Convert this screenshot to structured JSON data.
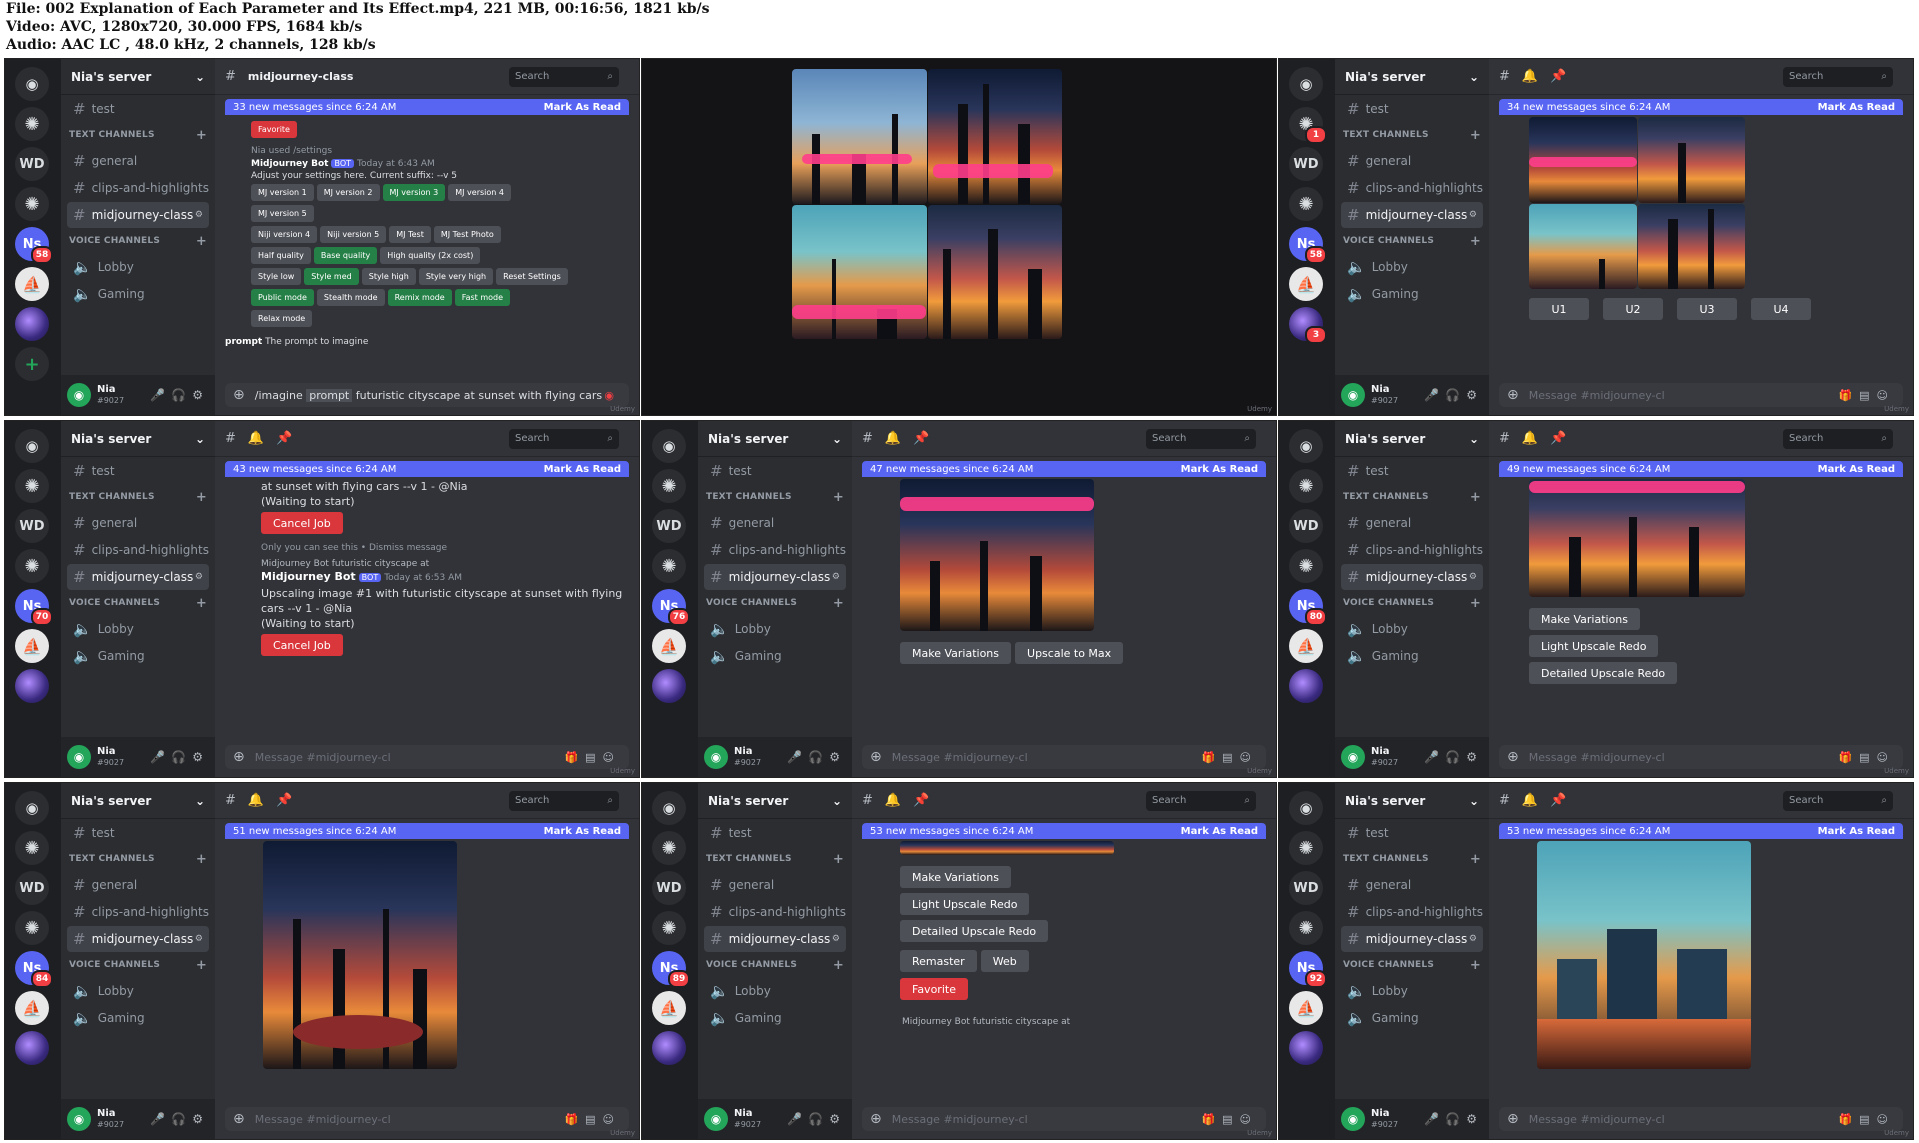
{
  "file_info": {
    "file": "File: 002 Explanation of Each Parameter and Its Effect.mp4, 221 MB, 00:16:56, 1821 kb/s",
    "video": "Video: AVC, 1280x720, 30.000 FPS, 1684 kb/s",
    "audio": "Audio: AAC LC , 48.0 kHz, 2 channels, 128 kb/s"
  },
  "discord": {
    "server_name": "Nia's server",
    "channels": {
      "test": "test",
      "text_category": "TEXT CHANNELS",
      "general": "general",
      "clips": "clips-and-highlights",
      "midjourney": "midjourney-class",
      "voice_category": "VOICE CHANNELS",
      "lobby": "Lobby",
      "gaming": "Gaming"
    },
    "rail": {
      "wd": "WD",
      "ns": "Ns"
    },
    "user": {
      "name": "Nia",
      "tag": "#9027"
    },
    "search_placeholder": "Search",
    "mark_as_read": "Mark As Read",
    "compose_placeholder": "Message #midjourney-cl",
    "watermark": "Udemy"
  },
  "panel1": {
    "channel_title": "midjourney-class",
    "banner": "33 new messages since 6:24 AM",
    "favorite": "Favorite",
    "used": "Nia used /settings",
    "bot_name": "Midjourney Bot",
    "bot_tag": "BOT",
    "time": "Today at 6:43 AM",
    "settings_text": "Adjust your settings here. Current suffix: --v 5",
    "rows": [
      [
        "MJ version 1",
        "MJ version 2",
        "MJ version 3",
        "MJ version 4"
      ],
      [
        "MJ version 5"
      ],
      [
        "Niji version 4",
        "Niji version 5",
        "MJ Test",
        "MJ Test Photo"
      ],
      [
        "Half quality",
        "Base quality",
        "High quality (2x cost)"
      ],
      [
        "Style low",
        "Style med",
        "Style high",
        "Style very high",
        "Reset Settings"
      ],
      [
        "Public mode",
        "Stealth mode",
        "Remix mode",
        "Fast mode"
      ],
      [
        "Relax mode"
      ]
    ],
    "prompt_hint_label": "prompt",
    "prompt_hint": "The prompt to imagine",
    "command": "/imagine",
    "command_arg": "prompt",
    "command_text": "futuristic cityscape at sunset with flying cars",
    "badge_ns": "58"
  },
  "panel3": {
    "banner": "34 new messages since 6:24 AM",
    "upscale_buttons": [
      "U1",
      "U2",
      "U3",
      "U4"
    ],
    "badge_ns": "58",
    "badge_gal": "3",
    "badge_gpt": "1"
  },
  "panel4": {
    "banner": "43 new messages since 6:24 AM",
    "line1": "at sunset with flying cars --v 1 - @Nia",
    "waiting": "(Waiting to start)",
    "cancel": "Cancel Job",
    "ephemeral": "Only you can see this • Dismiss message",
    "bot_ref": "Midjourney Bot futuristic cityscape at",
    "bot_name": "Midjourney Bot",
    "bot_tag": "BOT",
    "time": "Today at 6:53 AM",
    "upscaling": "Upscaling image #1 with futuristic cityscape at sunset with flying cars --v 1 - @Nia",
    "badge_ns": "70"
  },
  "panel5": {
    "banner": "47 new messages since 6:24 AM",
    "buttons": [
      "Make Variations",
      "Upscale to Max"
    ],
    "badge_ns": "76"
  },
  "panel6": {
    "banner": "49 new messages since 6:24 AM",
    "buttons": [
      "Make Variations",
      "Light Upscale Redo",
      "Detailed Upscale Redo"
    ],
    "badge_ns": "80"
  },
  "panel7": {
    "banner": "51 new messages since 6:24 AM",
    "badge_ns": "84"
  },
  "panel8": {
    "banner": "53 new messages since 6:24 AM",
    "buttons": [
      "Make Variations",
      "Light Upscale Redo",
      "Detailed Upscale Redo",
      "Remaster",
      "Web",
      "Favorite"
    ],
    "bot_ref": "Midjourney Bot futuristic cityscape at",
    "badge_ns": "89"
  },
  "panel9": {
    "banner": "53 new messages since 6:24 AM",
    "badge_ns": "92"
  }
}
